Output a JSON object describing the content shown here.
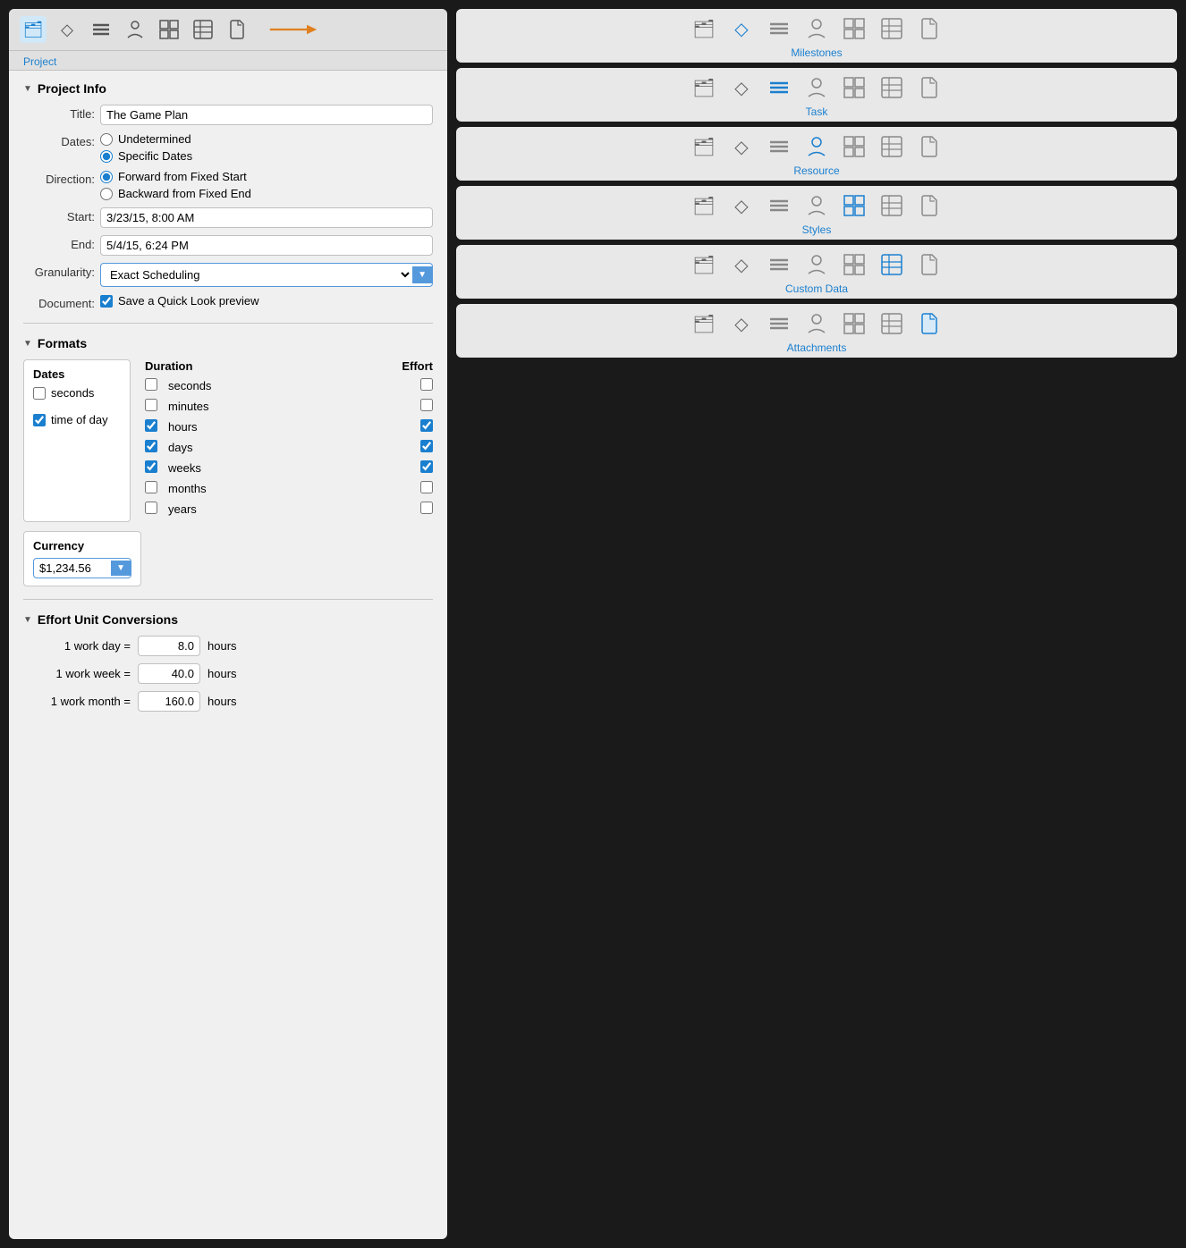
{
  "toolbar": {
    "icons": [
      {
        "name": "project-icon",
        "symbol": "🗂",
        "active": true
      },
      {
        "name": "milestone-icon",
        "symbol": "◇",
        "active": false
      },
      {
        "name": "task-icon",
        "symbol": "≡",
        "active": false
      },
      {
        "name": "resource-icon",
        "symbol": "👤",
        "active": false
      },
      {
        "name": "styles-icon",
        "symbol": "⊞",
        "active": false
      },
      {
        "name": "custom-data-icon",
        "symbol": "⊟",
        "active": false
      },
      {
        "name": "attachments-icon",
        "symbol": "⎋",
        "active": false
      }
    ],
    "active_label": "Project"
  },
  "project_info": {
    "section_label": "Project Info",
    "title_label": "Title:",
    "title_value": "The Game Plan",
    "dates_label": "Dates:",
    "dates_options": [
      {
        "label": "Undetermined",
        "checked": false
      },
      {
        "label": "Specific Dates",
        "checked": true
      }
    ],
    "direction_label": "Direction:",
    "direction_options": [
      {
        "label": "Forward from Fixed Start",
        "checked": true
      },
      {
        "label": "Backward from Fixed End",
        "checked": false
      }
    ],
    "start_label": "Start:",
    "start_value": "3/23/15, 8:00 AM",
    "end_label": "End:",
    "end_value": "5/4/15, 6:24 PM",
    "granularity_label": "Granularity:",
    "granularity_value": "Exact Scheduling",
    "document_label": "Document:",
    "document_checkbox_label": "Save a Quick Look preview",
    "document_checked": true
  },
  "formats": {
    "section_label": "Formats",
    "dates_col": {
      "header": "Dates",
      "items": [
        {
          "label": "seconds",
          "checked": false
        },
        {
          "label": "time of day",
          "checked": true
        }
      ]
    },
    "duration_col": {
      "header": "Duration",
      "effort_header": "Effort",
      "rows": [
        {
          "label": "seconds",
          "left_checked": false,
          "right_checked": false
        },
        {
          "label": "minutes",
          "left_checked": false,
          "right_checked": false
        },
        {
          "label": "hours",
          "left_checked": true,
          "right_checked": true
        },
        {
          "label": "days",
          "left_checked": true,
          "right_checked": true
        },
        {
          "label": "weeks",
          "left_checked": true,
          "right_checked": true
        },
        {
          "label": "months",
          "left_checked": false,
          "right_checked": false
        },
        {
          "label": "years",
          "left_checked": false,
          "right_checked": false
        }
      ]
    },
    "currency": {
      "header": "Currency",
      "value": "$1,234.56"
    }
  },
  "effort_conversions": {
    "section_label": "Effort Unit Conversions",
    "rows": [
      {
        "label": "1 work day =",
        "value": "8.0",
        "unit": "hours"
      },
      {
        "label": "1 work week =",
        "value": "40.0",
        "unit": "hours"
      },
      {
        "label": "1 work month =",
        "value": "160.0",
        "unit": "hours"
      }
    ]
  },
  "right_panel": {
    "cards": [
      {
        "id": "milestones",
        "label": "Milestones",
        "active_icon_index": 1,
        "icons": [
          "🗂",
          "◇",
          "≡",
          "👤",
          "⊞",
          "⊟",
          "⎋"
        ]
      },
      {
        "id": "task",
        "label": "Task",
        "active_icon_index": 2,
        "icons": [
          "🗂",
          "◇",
          "≡",
          "👤",
          "⊞",
          "⊟",
          "⎋"
        ]
      },
      {
        "id": "resource",
        "label": "Resource",
        "active_icon_index": 3,
        "icons": [
          "🗂",
          "◇",
          "≡",
          "👤",
          "⊞",
          "⊟",
          "⎋"
        ]
      },
      {
        "id": "styles",
        "label": "Styles",
        "active_icon_index": 4,
        "icons": [
          "🗂",
          "◇",
          "≡",
          "👤",
          "⊞",
          "⊟",
          "⎋"
        ]
      },
      {
        "id": "custom-data",
        "label": "Custom Data",
        "active_icon_index": 5,
        "icons": [
          "🗂",
          "◇",
          "≡",
          "👤",
          "⊞",
          "⊟",
          "⎋"
        ]
      },
      {
        "id": "attachments",
        "label": "Attachments",
        "active_icon_index": 6,
        "icons": [
          "🗂",
          "◇",
          "≡",
          "👤",
          "⊞",
          "⊟",
          "⎋"
        ]
      }
    ]
  }
}
